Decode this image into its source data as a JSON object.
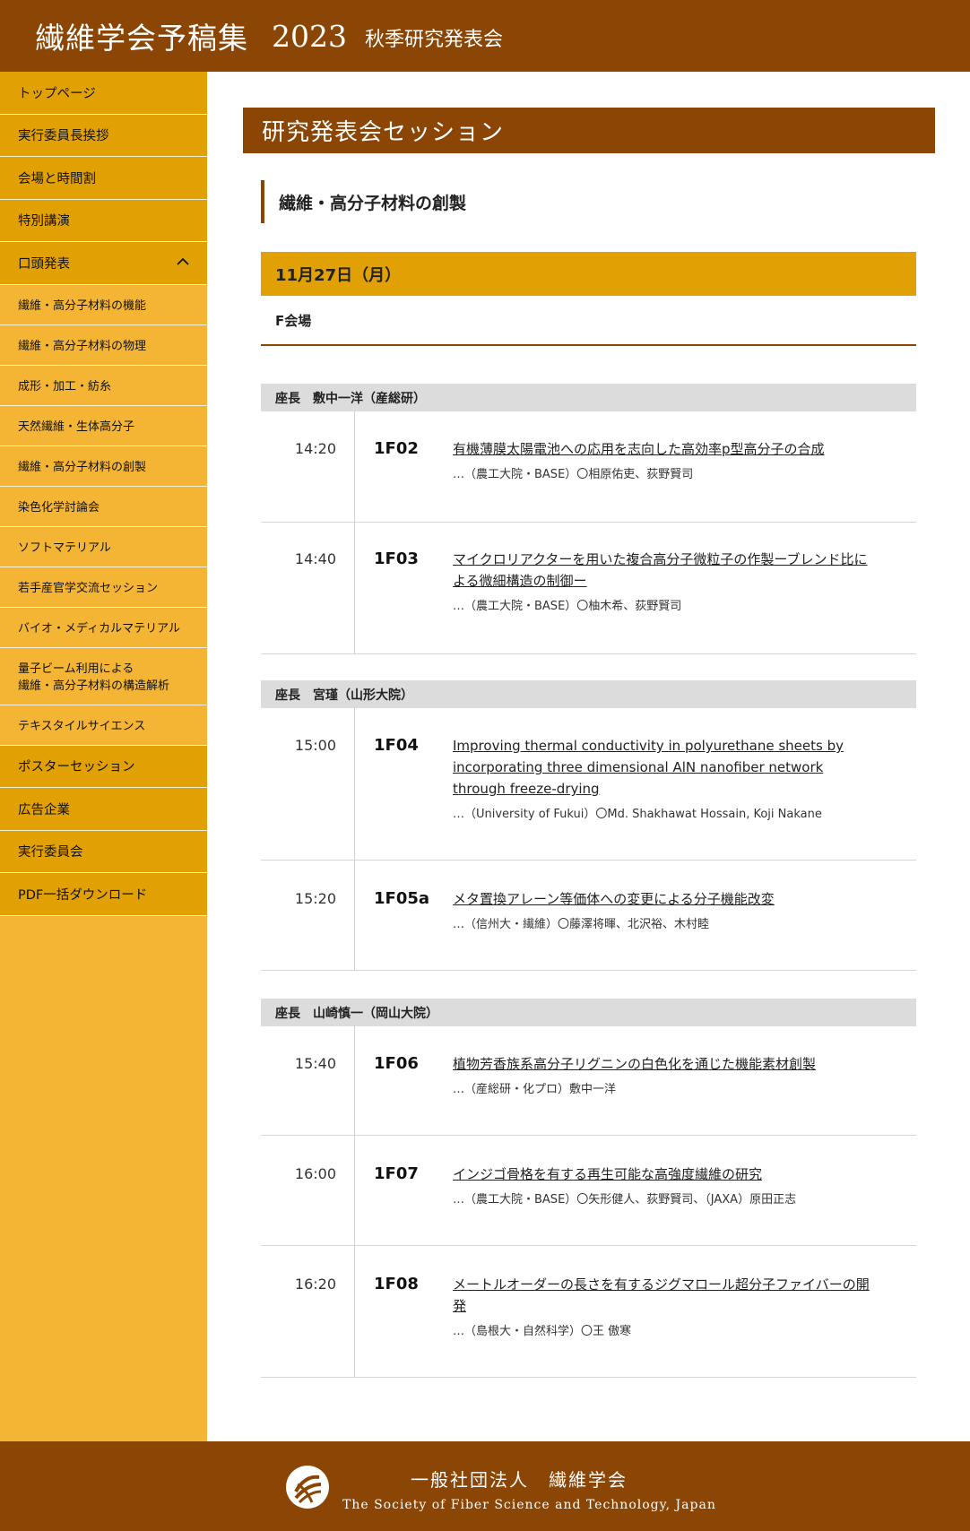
{
  "header": {
    "title": "繊維学会予稿集",
    "year": "2023",
    "subtitle": "秋季研究発表会"
  },
  "sidebar": {
    "items": [
      {
        "label": "トップページ",
        "type": "main"
      },
      {
        "label": "実行委員長挨拶",
        "type": "main"
      },
      {
        "label": "会場と時間割",
        "type": "main"
      },
      {
        "label": "特別講演",
        "type": "main"
      },
      {
        "label": "口頭発表",
        "type": "main",
        "expanded": true
      },
      {
        "label": "繊維・高分子材料の機能",
        "type": "sub"
      },
      {
        "label": "繊維・高分子材料の物理",
        "type": "sub"
      },
      {
        "label": "成形・加工・紡糸",
        "type": "sub"
      },
      {
        "label": "天然繊維・生体高分子",
        "type": "sub"
      },
      {
        "label": "繊維・高分子材料の創製",
        "type": "sub"
      },
      {
        "label": "染色化学討論会",
        "type": "sub"
      },
      {
        "label": "ソフトマテリアル",
        "type": "sub"
      },
      {
        "label": "若手産官学交流セッション",
        "type": "sub"
      },
      {
        "label": "バイオ・メディカルマテリアル",
        "type": "sub"
      },
      {
        "label": "量子ビーム利用による",
        "label2": "繊維・高分子材料の構造解析",
        "type": "sub"
      },
      {
        "label": "テキスタイルサイエンス",
        "type": "sub"
      },
      {
        "label": "ポスターセッション",
        "type": "main"
      },
      {
        "label": "広告企業",
        "type": "main"
      },
      {
        "label": "実行委員会",
        "type": "main"
      },
      {
        "label": "PDF一括ダウンロード",
        "type": "main"
      }
    ]
  },
  "main": {
    "section_title": "研究発表会セッション",
    "topic": "繊維・高分子材料の創製",
    "date": "11月27日（月）",
    "venue": "F会場",
    "chairs": [
      "座長　敷中一洋（産総研）",
      "座長　宮瑾（山形大院）",
      "座長　山崎慎一（岡山大院）"
    ],
    "presentations": [
      {
        "time": "14:20",
        "code": "1F02",
        "title": "有機薄膜太陽電池への応用を志向した高効率p型高分子の合成",
        "authors": "…（農工大院・BASE）〇相原佑吏、荻野賢司"
      },
      {
        "time": "14:40",
        "code": "1F03",
        "title": "マイクロリアクターを用いた複合高分子微粒子の作製ーブレンド比による微細構造の制御ー",
        "authors": "…（農工大院・BASE）〇柚木希、荻野賢司"
      },
      {
        "time": "15:00",
        "code": "1F04",
        "title": "Improving thermal conductivity in polyurethane sheets by incorporating three dimensional AlN nanofiber network through freeze-drying",
        "authors": "…（University of Fukui）〇Md. Shakhawat Hossain, Koji Nakane"
      },
      {
        "time": "15:20",
        "code": "1F05a",
        "title": "メタ置換アレーン等価体への変更による分子機能改変",
        "authors": "…（信州大・繊維）〇藤澤将暉、北沢裕、木村睦"
      },
      {
        "time": "15:40",
        "code": "1F06",
        "title": "植物芳香族系高分子リグニンの白色化を通じた機能素材創製",
        "authors": "…（産総研・化プロ）敷中一洋"
      },
      {
        "time": "16:00",
        "code": "1F07",
        "title": "インジゴ骨格を有する再生可能な高強度繊維の研究",
        "authors": "…（農工大院・BASE）〇矢形健人、荻野賢司、（JAXA）原田正志"
      },
      {
        "time": "16:20",
        "code": "1F08",
        "title": "メートルオーダーの長さを有するジグマロール超分子ファイバーの開発",
        "authors": "…（島根大・自然科学）〇王 傲寒"
      }
    ]
  },
  "footer": {
    "org": "一般社団法人　繊維学会",
    "org_en": "The Society of Fiber Science and Technology, Japan"
  }
}
